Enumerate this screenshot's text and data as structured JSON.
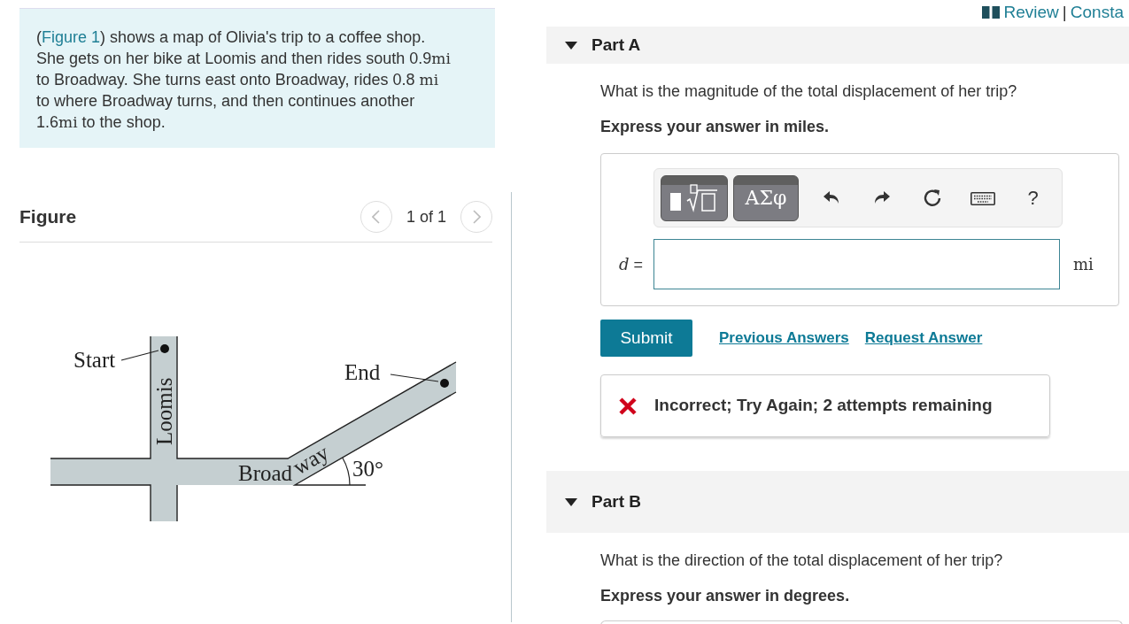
{
  "header_links": {
    "review": "Review",
    "separator": "|",
    "constants": "Consta"
  },
  "problem": {
    "segments": [
      {
        "kind": "text",
        "text": "("
      },
      {
        "kind": "link",
        "text": "Figure 1"
      },
      {
        "kind": "text",
        "text": ") shows a map of Olivia's trip to a coffee shop. She gets on her bike at Loomis and then rides south 0.9"
      },
      {
        "kind": "unit",
        "text": "mi"
      },
      {
        "kind": "text",
        "text": " to Broadway. She turns east onto Broadway, rides 0.8 "
      },
      {
        "kind": "unit",
        "text": "mi"
      },
      {
        "kind": "text",
        "text": " to where Broadway turns, and then continues another 1.6"
      },
      {
        "kind": "unit",
        "text": "mi"
      },
      {
        "kind": "text",
        "text": " to the shop."
      }
    ]
  },
  "figure": {
    "title": "Figure",
    "pager": "1 of 1",
    "prev_disabled": true,
    "next_disabled": true,
    "labels": {
      "start": "Start",
      "end": "End",
      "street_1": "Loomis",
      "street_2_a": "Broad",
      "street_2_b": "way",
      "angle": "30°"
    }
  },
  "parts": [
    {
      "label": "Part A",
      "expanded": true,
      "question": "What is the magnitude of the total displacement of her trip?",
      "instruction": "Express your answer in miles.",
      "answer": {
        "toolbar": {
          "symbols": "ΑΣφ",
          "help": "?"
        },
        "variable": "d",
        "equals": "=",
        "unit": "mi"
      },
      "submit": "Submit",
      "links": [
        "Previous Answers",
        "Request Answer"
      ],
      "feedback": {
        "kind": "incorrect",
        "text": "Incorrect; Try Again; 2 attempts remaining"
      }
    },
    {
      "label": "Part B",
      "expanded": true,
      "question": "What is the direction of the total displacement of her trip?",
      "instruction": "Express your answer in degrees."
    }
  ]
}
